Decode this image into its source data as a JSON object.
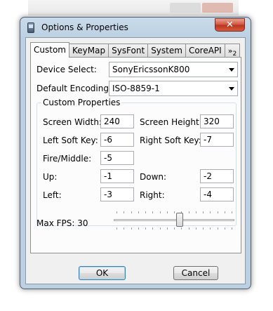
{
  "window": {
    "title": "Options & Properties",
    "close_symbol": "✕",
    "app_icon": "phone-icon"
  },
  "tabs": [
    {
      "label": "Custom",
      "active": true
    },
    {
      "label": "KeyMap",
      "active": false
    },
    {
      "label": "SysFont",
      "active": false
    },
    {
      "label": "System",
      "active": false
    },
    {
      "label": "CoreAPI",
      "active": false
    }
  ],
  "tab_overflow": {
    "symbol": "»",
    "count": "2"
  },
  "device": {
    "label": "Device Select:",
    "value": "SonyEricssonK800"
  },
  "encoding": {
    "label": "Default Encoding:",
    "value": "ISO-8859-1"
  },
  "custom_properties": {
    "title": "Custom Properties",
    "screen_width": {
      "label": "Screen Width:",
      "value": "240"
    },
    "screen_height": {
      "label": "Screen Height:",
      "value": "320"
    },
    "left_soft_key": {
      "label": "Left Soft Key:",
      "value": "-6"
    },
    "right_soft_key": {
      "label": "Right Soft Key:",
      "value": "-7"
    },
    "fire_middle": {
      "label": "Fire/Middle:",
      "value": "-5"
    },
    "up": {
      "label": "Up:",
      "value": "-1"
    },
    "down": {
      "label": "Down:",
      "value": "-2"
    },
    "left": {
      "label": "Left:",
      "value": "-3"
    },
    "right": {
      "label": "Right:",
      "value": "-4"
    }
  },
  "max_fps": {
    "label": "Max FPS: 30",
    "slider_fraction": 0.55
  },
  "buttons": {
    "ok": "OK",
    "cancel": "Cancel"
  },
  "colors": {
    "frame": "#bcd0e2",
    "close": "#c7412b",
    "panel": "#fcfcfc"
  }
}
